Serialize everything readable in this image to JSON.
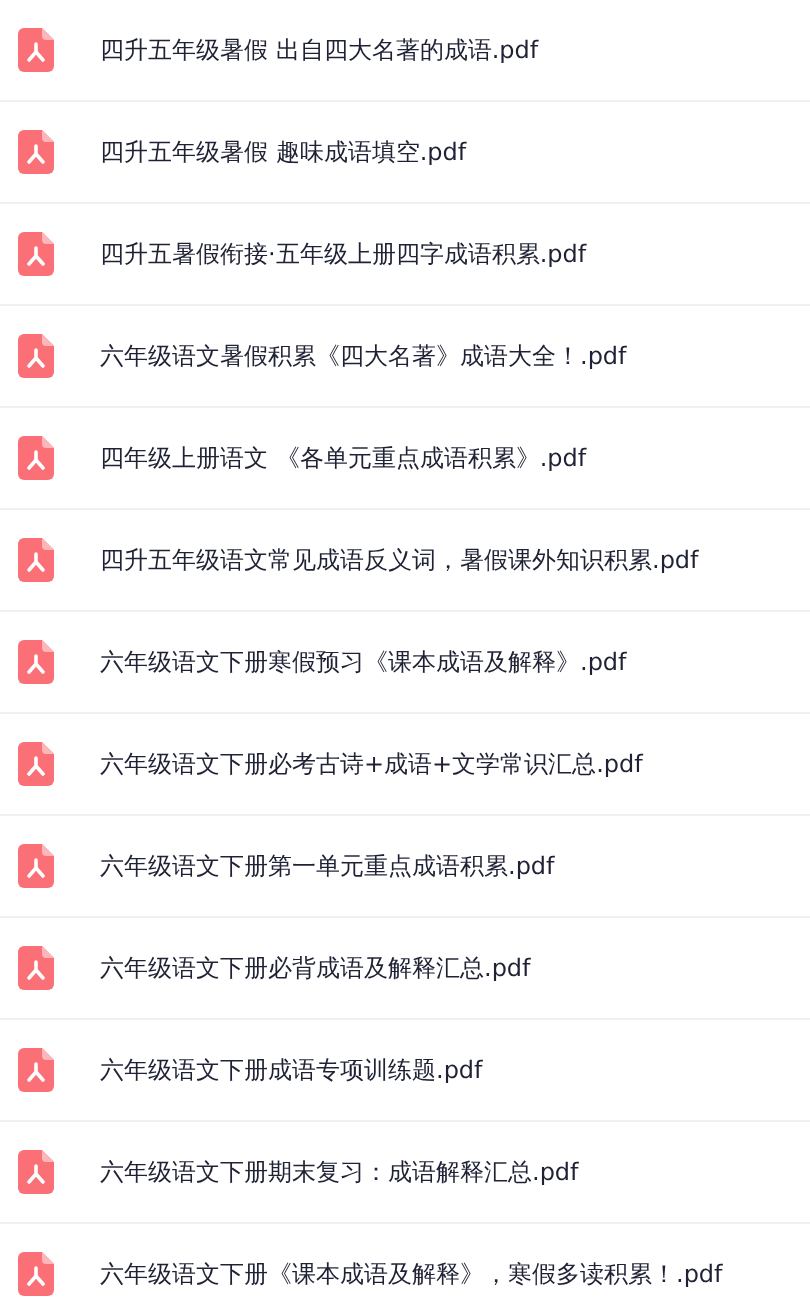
{
  "files": [
    {
      "name": "四升五年级暑假 出自四大名著的成语.pdf"
    },
    {
      "name": "四升五年级暑假 趣味成语填空.pdf"
    },
    {
      "name": "四升五暑假衔接·五年级上册四字成语积累.pdf"
    },
    {
      "name": "六年级语文暑假积累《四大名著》成语大全！.pdf"
    },
    {
      "name": "四年级上册语文 《各单元重点成语积累》.pdf"
    },
    {
      "name": "四升五年级语文常见成语反义词，暑假课外知识积累.pdf"
    },
    {
      "name": "六年级语文下册寒假预习《课本成语及解释》.pdf"
    },
    {
      "name": "六年级语文下册必考古诗+成语+文学常识汇总.pdf"
    },
    {
      "name": "六年级语文下册第一单元重点成语积累.pdf"
    },
    {
      "name": "六年级语文下册必背成语及解释汇总.pdf"
    },
    {
      "name": "六年级语文下册成语专项训练题.pdf"
    },
    {
      "name": "六年级语文下册期末复习：成语解释汇总.pdf"
    },
    {
      "name": "六年级语文下册《课本成语及解释》，寒假多读积累！.pdf"
    }
  ]
}
